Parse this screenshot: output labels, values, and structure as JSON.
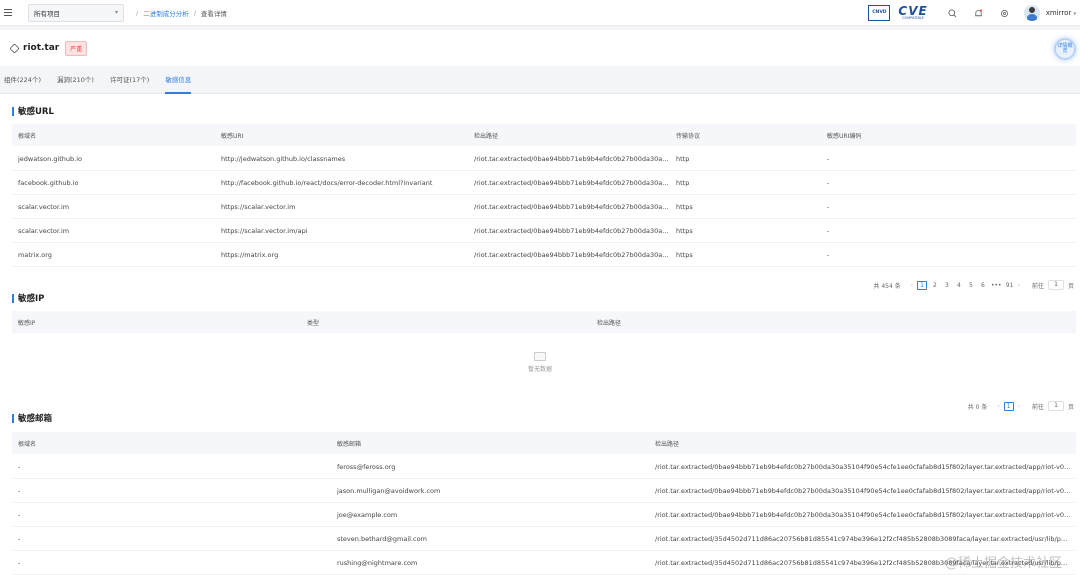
{
  "topbar": {
    "project_select": "所有项目",
    "breadcrumb": [
      "二进制成分分析",
      "查看详情"
    ],
    "logos": {
      "cnvd": "CNVD",
      "cve": "CVE",
      "cve_sub": "COMPATIBLE"
    },
    "username": "xmirror"
  },
  "title": {
    "name": "riot.tar",
    "severity": "严重",
    "detail_button": "详情概览"
  },
  "tabs": [
    {
      "label": "组件(224个)",
      "active": false
    },
    {
      "label": "漏洞(210个)",
      "active": false
    },
    {
      "label": "许可证(17个)",
      "active": false
    },
    {
      "label": "敏感信息",
      "active": true
    }
  ],
  "sensitive_url": {
    "title": "敏感URL",
    "headers": [
      "根域名",
      "敏感URI",
      "检出路径",
      "传输协议",
      "敏感URI编码"
    ],
    "rows": [
      [
        "jedwatson.github.io",
        "http://jedwatson.github.io/classnames",
        "/riot.tar.extracted/0bae94bbb71eb9b4efdc0b27b00da30a3...",
        "http",
        "-"
      ],
      [
        "facebook.github.io",
        "http://facebook.github.io/react/docs/error-decoder.html?invariant",
        "/riot.tar.extracted/0bae94bbb71eb9b4efdc0b27b00da30a3...",
        "http",
        "-"
      ],
      [
        "scalar.vector.im",
        "https://scalar.vector.im",
        "/riot.tar.extracted/0bae94bbb71eb9b4efdc0b27b00da30a3...",
        "https",
        "-"
      ],
      [
        "scalar.vector.im",
        "https://scalar.vector.im/api",
        "/riot.tar.extracted/0bae94bbb71eb9b4efdc0b27b00da30a3...",
        "https",
        "-"
      ],
      [
        "matrix.org",
        "https://matrix.org",
        "/riot.tar.extracted/0bae94bbb71eb9b4efdc0b27b00da30a3...",
        "https",
        "-"
      ]
    ],
    "pager": {
      "total": "共 454 条",
      "pages": [
        "1",
        "2",
        "3",
        "4",
        "5",
        "6",
        "•••",
        "91"
      ],
      "goto_label": "前往",
      "goto_value": "1",
      "goto_unit": "页"
    }
  },
  "sensitive_ip": {
    "title": "敏感IP",
    "headers": [
      "敏感IP",
      "类型",
      "检出路径"
    ],
    "empty_text": "暂无数据",
    "pager": {
      "total": "共 0 条",
      "pages": [
        "1"
      ],
      "goto_label": "前往",
      "goto_value": "1",
      "goto_unit": "页"
    }
  },
  "sensitive_email": {
    "title": "敏感邮箱",
    "headers": [
      "根域名",
      "敏感邮箱",
      "检出路径"
    ],
    "rows": [
      [
        "-",
        "feross@feross.org",
        "/riot.tar.extracted/0bae94bbb71eb9b4efdc0b27b00da30a35104f90e54cfe1ee0cfafab8d15f802/layer.tar.extracted/app/riot-v0.16.0/..."
      ],
      [
        "-",
        "jason.mulligan@avoidwork.com",
        "/riot.tar.extracted/0bae94bbb71eb9b4efdc0b27b00da30a35104f90e54cfe1ee0cfafab8d15f802/layer.tar.extracted/app/riot-v0.16.0/..."
      ],
      [
        "-",
        "joe@example.com",
        "/riot.tar.extracted/0bae94bbb71eb9b4efdc0b27b00da30a35104f90e54cfe1ee0cfafab8d15f802/layer.tar.extracted/app/riot-v0.16.0/..."
      ],
      [
        "-",
        "steven.bethard@gmail.com",
        "/riot.tar.extracted/35d4502d711d86ac20756b81d85541c974be396e12f2cf485b52808b3089faca/layer.tar.extracted/usr/lib/python3..."
      ],
      [
        "-",
        "rushing@nightmare.com",
        "/riot.tar.extracted/35d4502d711d86ac20756b81d85541c974be396e12f2cf485b52808b3089faca/layer.tar.extracted/usr/lib/python3..."
      ]
    ]
  },
  "watermark": "@稀土掘金技术社区"
}
